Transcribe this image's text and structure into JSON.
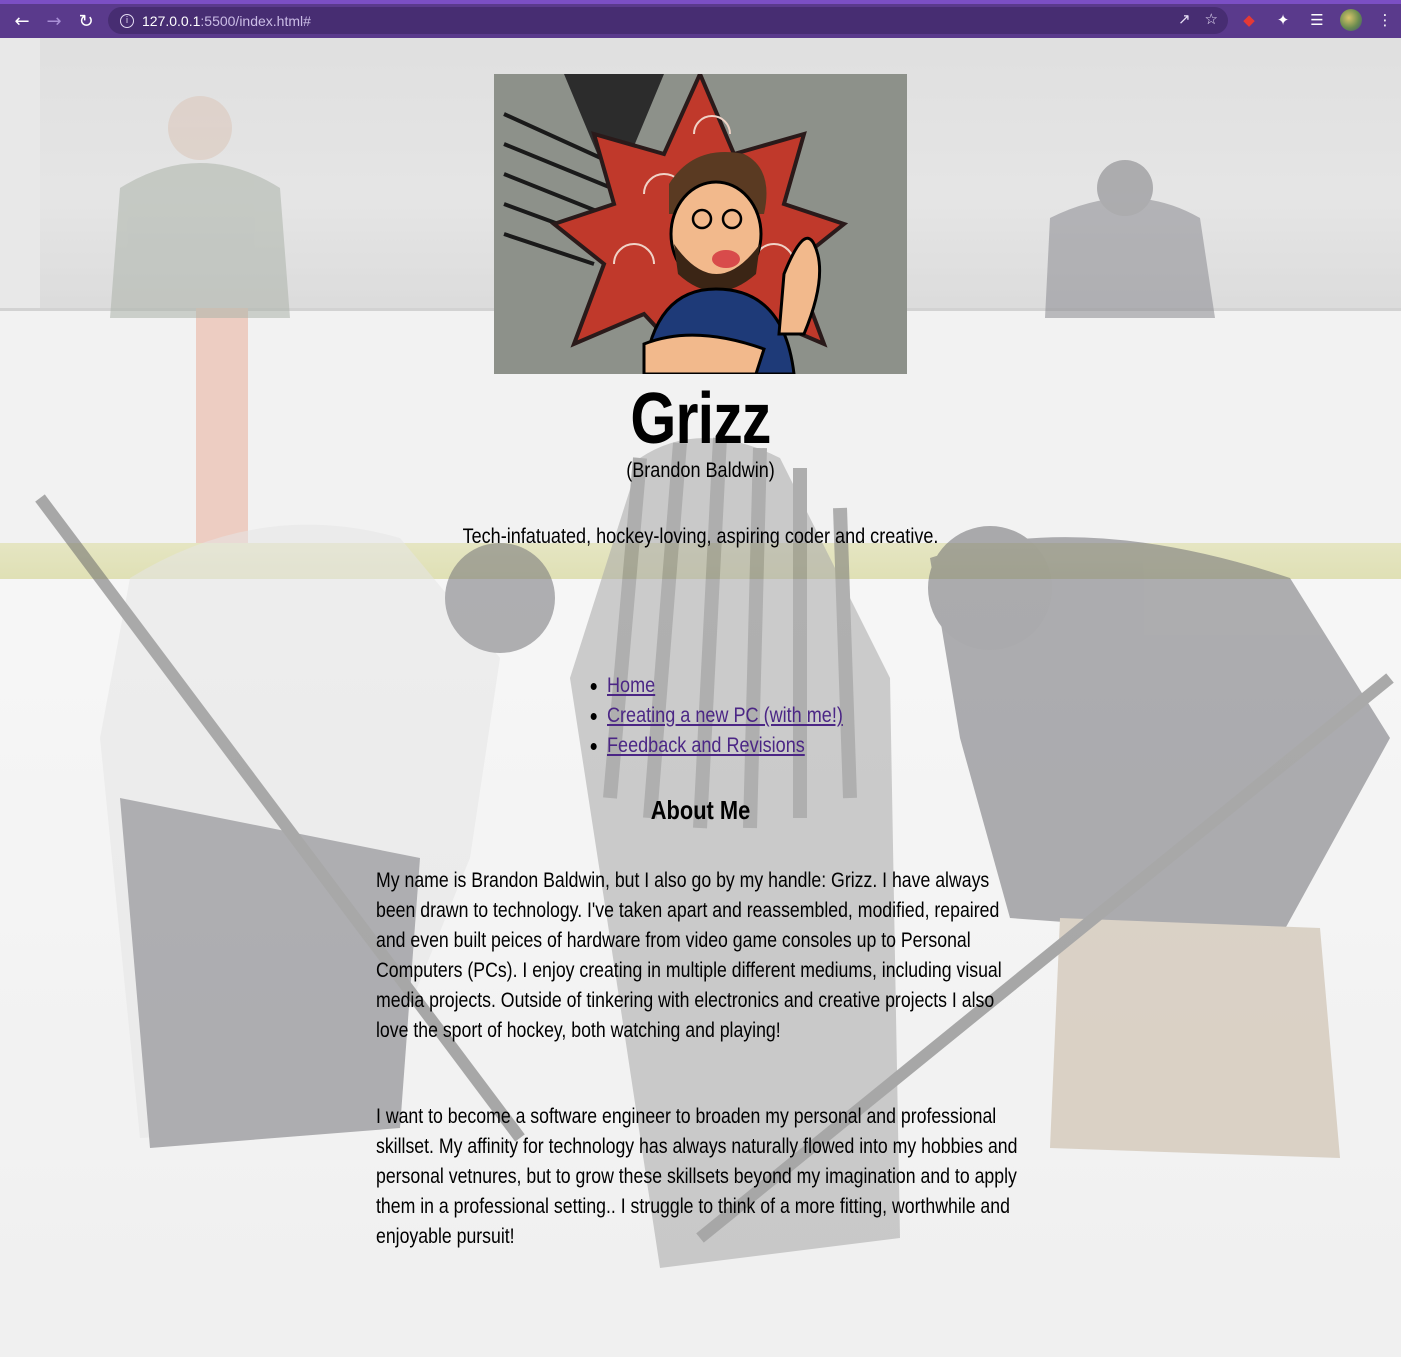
{
  "browser": {
    "url_host": "127.0.0.1",
    "url_rest": ":5500/index.html#",
    "back_icon": "arrow-left-icon",
    "forward_icon": "arrow-right-icon",
    "reload_icon": "reload-icon",
    "colors": {
      "toolbar": "#5a3a8c",
      "omnibox": "#472d72"
    }
  },
  "header": {
    "name": "Grizz",
    "real_name": "(Brandon Baldwin)",
    "tagline": "Tech-infatuated, hockey-loving, aspiring coder and creative."
  },
  "nav": {
    "items": [
      {
        "label": "Home"
      },
      {
        "label": "Creating a new PC (with me!)"
      },
      {
        "label": "Feedback and Revisions"
      }
    ],
    "link_color": "#4b2685"
  },
  "about": {
    "title": "About Me",
    "paragraphs": [
      "My name is Brandon Baldwin, but I also go by my handle: Grizz. I have always been drawn to technology. I've taken apart and reassembled, modified, repaired and even built peices of hardware from video game consoles up to Personal Computers (PCs). I enjoy creating in multiple different mediums, including visual media projects. Outside of tinkering with electronics and creative projects I also love the sport of hockey, both watching and playing!",
      "I want to become a software engineer to broaden my personal and professional skillset. My affinity for technology has always naturally flowed into my hobbies and personal vetnures, but to grow these skillsets beyond my imagination and to apply them in a professional setting.. I struggle to think of a more fitting, worthwhile and enjoyable pursuit!"
    ]
  }
}
